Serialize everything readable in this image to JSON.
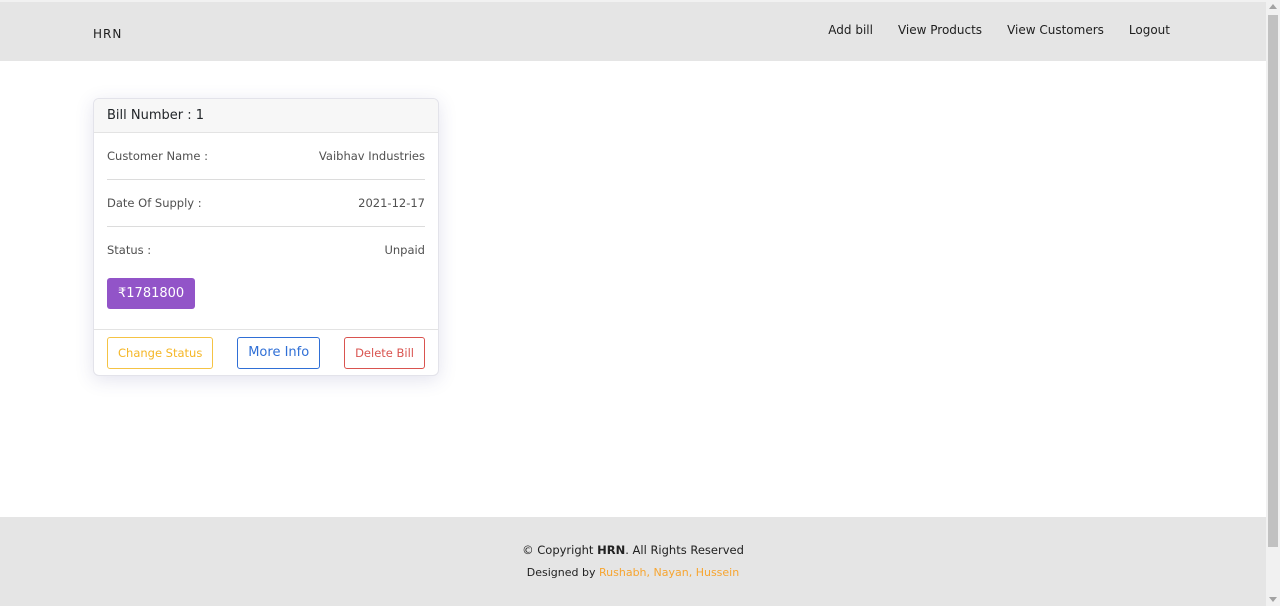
{
  "navbar": {
    "brand": "HRN",
    "links": [
      "Add bill",
      "View Products",
      "View Customers",
      "Logout"
    ]
  },
  "bill_card": {
    "title": "Bill Number : 1",
    "customer_label": "Customer Name :",
    "customer_value": "Vaibhav Industries",
    "date_label": "Date Of Supply :",
    "date_value": "2021-12-17",
    "status_label": "Status :",
    "status_value": "Unpaid",
    "amount": "₹1781800",
    "buttons": {
      "change_status": "Change Status",
      "more_info": "More Info",
      "delete_bill": "Delete Bill"
    }
  },
  "footer": {
    "copyright_prefix": "© Copyright",
    "copyright_brand": "HRN",
    "copyright_suffix": ". All Rights Reserved",
    "designed_by_prefix": "Designed by",
    "designed_by_authors": "Rushabh, Nayan, Hussein"
  },
  "colors": {
    "accent_purple": "#9254c8",
    "warning": "#f5c344",
    "primary": "#2f6fd6",
    "danger": "#d9534f",
    "author_orange": "#f7a530"
  }
}
